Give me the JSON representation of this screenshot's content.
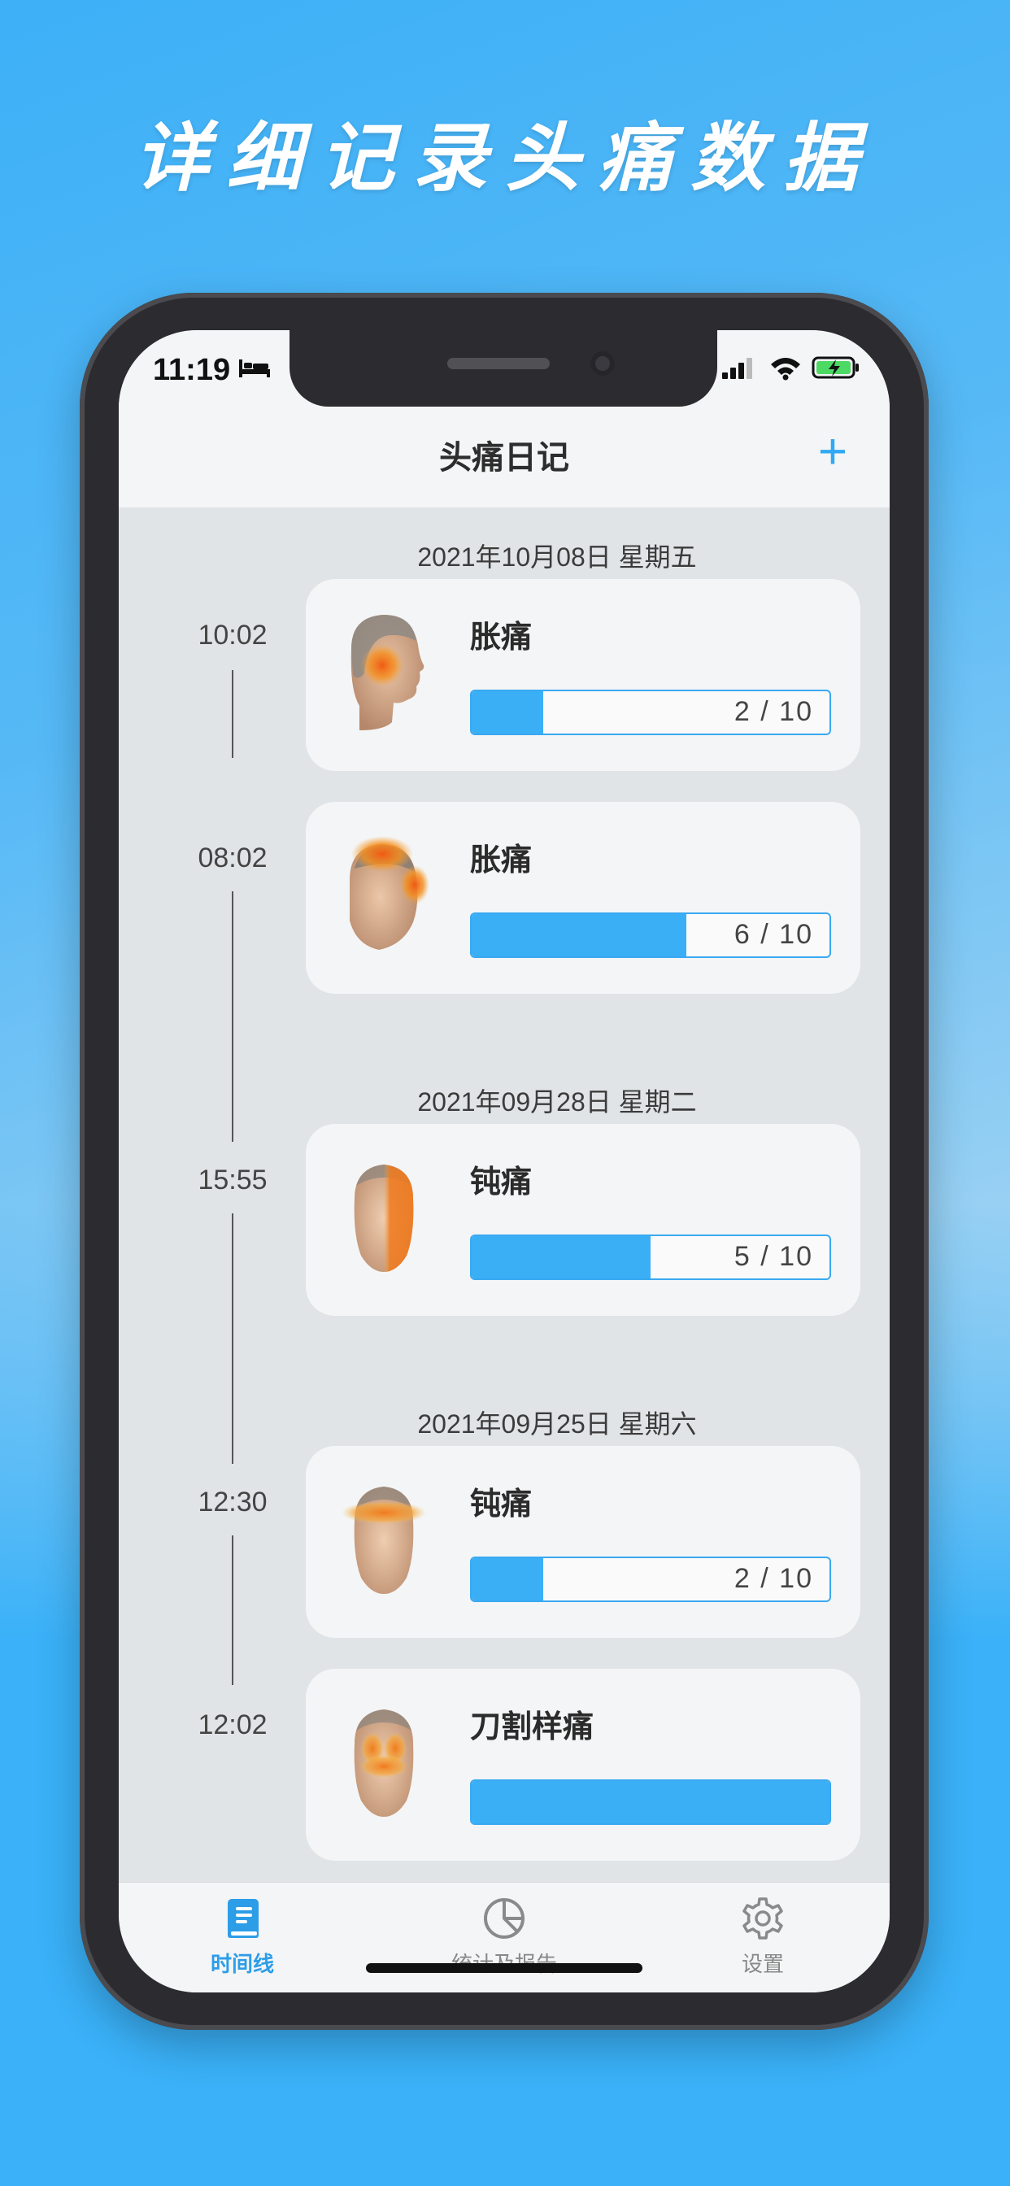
{
  "promo": {
    "title": "详细记录头痛数据"
  },
  "status_bar": {
    "time": "11:19"
  },
  "nav": {
    "title": "头痛日记",
    "add_label": "+"
  },
  "timeline": {
    "groups": [
      {
        "date": "2021年10月08日 星期五",
        "entries": [
          {
            "time": "10:02",
            "pain_type": "胀痛",
            "score": "2 / 10",
            "level": 0.2,
            "head": "side-temple"
          },
          {
            "time": "08:02",
            "pain_type": "胀痛",
            "score": "6 / 10",
            "level": 0.6,
            "head": "three-quarter-top"
          }
        ]
      },
      {
        "date": "2021年09月28日 星期二",
        "entries": [
          {
            "time": "15:55",
            "pain_type": "钝痛",
            "score": "5 / 10",
            "level": 0.5,
            "head": "front-half"
          }
        ]
      },
      {
        "date": "2021年09月25日 星期六",
        "entries": [
          {
            "time": "12:30",
            "pain_type": "钝痛",
            "score": "2 / 10",
            "level": 0.2,
            "head": "front-forehead"
          },
          {
            "time": "12:02",
            "pain_type": "刀割样痛",
            "score": "",
            "level": 1.0,
            "head": "front-sinus"
          }
        ]
      }
    ]
  },
  "tabs": [
    {
      "label": "时间线",
      "icon": "book-icon",
      "active": true
    },
    {
      "label": "统计及报告",
      "icon": "pie-chart-icon",
      "active": false
    },
    {
      "label": "设置",
      "icon": "gear-icon",
      "active": false
    }
  ],
  "colors": {
    "accent": "#31a9f2",
    "bar_fill": "#3aaff5",
    "pain_spot": "#f07a1e"
  }
}
